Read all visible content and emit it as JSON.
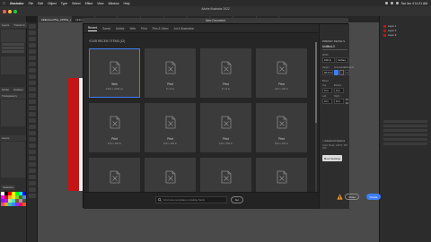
{
  "menubar": {
    "app": "Illustrator",
    "items": [
      "File",
      "Edit",
      "Object",
      "Type",
      "Select",
      "Effect",
      "View",
      "Window",
      "Help"
    ],
    "clock": "Sat Jun 4 11:21 AM"
  },
  "app_title": "Adobe Illustrator 2022",
  "doc_tabs": [
    "FEELGoodThe_APPLE_Logo @ 67 % (CMYK/Preview)",
    "FEELGood...",
    "FEELGood...",
    "FEELGood...",
    "FEELGood...",
    "FEELGood...",
    "FEELGood...",
    "FEELGood...",
    "FEELGood...",
    "FEELGood..."
  ],
  "left_panel": {
    "tabs": [
      "Layers",
      "Transform"
    ],
    "section_tabs": [
      "Stroke",
      "Gradient",
      "Transparency"
    ],
    "sub_tabs": [
      "Layers"
    ],
    "swatches_label": "Swatches",
    "swatch_colors": [
      "#ffffff",
      "#000000",
      "#ff0000",
      "#ffff00",
      "#00ff00",
      "#00ffff",
      "#0000ff",
      "#ff00ff",
      "#c8102e",
      "#f6a623",
      "#f8e71c",
      "#7ed321",
      "#417505",
      "#4a90e2",
      "#9013fe",
      "#bd10e0",
      "#b8e986",
      "#50e3c2",
      "#8b572a",
      "#9b9b9b",
      "#4a4a4a",
      "#e94e77",
      "#ff9f1c",
      "#2ec4b6",
      "#3a86ff",
      "#8338ec",
      "#ff006e",
      "#fb5607"
    ]
  },
  "right_panel": {
    "layers": [
      "Layer 1",
      "Layer 2",
      "Layer 3"
    ]
  },
  "dialog": {
    "title": "New Document",
    "tabs": [
      "Recent",
      "Saved",
      "Mobile",
      "Web",
      "Print",
      "Film & Video",
      "Art & Illustration"
    ],
    "active_tab": "Recent",
    "recent_label": "YOUR RECENT ITEMS (12)",
    "items": [
      {
        "name": "Web",
        "dims": "1920 x 1080 px"
      },
      {
        "name": "Print",
        "dims": "8 x 8 in"
      },
      {
        "name": "Print",
        "dims": "8 x 8 in"
      },
      {
        "name": "Print",
        "dims": "100 x 100 in"
      },
      {
        "name": "Print",
        "dims": "100 x 100 in"
      },
      {
        "name": "Print",
        "dims": "100 x 100 in"
      },
      {
        "name": "Print",
        "dims": "100 x 100 in"
      },
      {
        "name": "Print",
        "dims": "100 x 100 in"
      },
      {
        "name": "Print",
        "dims": "8 x 8 in"
      },
      {
        "name": "Print",
        "dims": "100 x 100 in"
      },
      {
        "name": "Print",
        "dims": "100 x 100 in"
      },
      {
        "name": "Print",
        "dims": "100 x 100 in"
      }
    ],
    "search_placeholder": "Find more templates on Adobe Stock",
    "go_label": "Go",
    "details": {
      "header": "PRESET DETAILS",
      "doc_name": "Untitled-3",
      "width_label": "Width",
      "width": "100 in",
      "units": "Inches",
      "height_label": "Height",
      "height": "60.5 in",
      "orientation_label": "Orientation",
      "artboards_label": "Artboards",
      "artboards": "1",
      "bleed_label": "Bleed",
      "top_label": "Top",
      "top": "0 in",
      "bottom_label": "Bottom",
      "bottom": "0 in",
      "left_label": "Left",
      "left": "0 in",
      "right_label": "Right",
      "right": "0 in",
      "advanced": "> Advanced Options",
      "color_mode": "Color Mode: CMYK, PPI: 300",
      "more_settings": "More Settings"
    },
    "close_label": "Close",
    "create_label": "Create"
  }
}
